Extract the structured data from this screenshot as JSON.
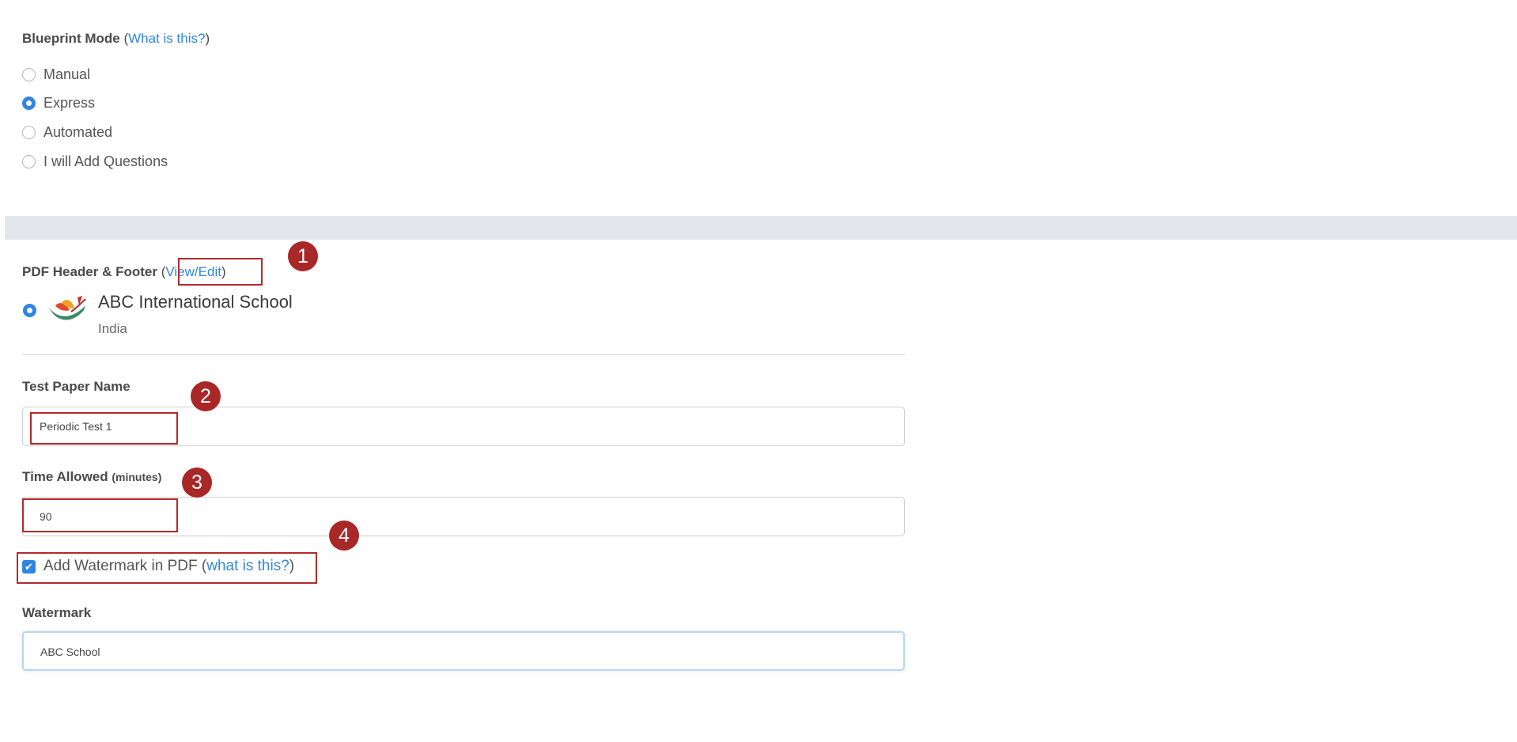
{
  "blueprint": {
    "label": "Blueprint Mode",
    "help_link": "What is this?",
    "options": [
      {
        "label": "Manual",
        "checked": false
      },
      {
        "label": "Express",
        "checked": true
      },
      {
        "label": "Automated",
        "checked": false
      },
      {
        "label": "I will Add Questions",
        "checked": false
      }
    ]
  },
  "pdf_header": {
    "label": "PDF Header & Footer",
    "link": "View/Edit",
    "school_name": "ABC International School",
    "school_country": "India"
  },
  "test_paper": {
    "label": "Test Paper Name",
    "value": "Periodic Test 1"
  },
  "time_allowed": {
    "label": "Time Allowed",
    "unit": "(minutes)",
    "value": "90"
  },
  "watermark_toggle": {
    "label": "Add Watermark in PDF",
    "help_link": "what is this?",
    "checked": true
  },
  "watermark": {
    "label": "Watermark",
    "value": "ABC School"
  },
  "annotations": [
    "1",
    "2",
    "3",
    "4"
  ],
  "colors": {
    "accent": "#2f86e0",
    "annotation": "#a92727",
    "band": "#e3e7ec"
  }
}
